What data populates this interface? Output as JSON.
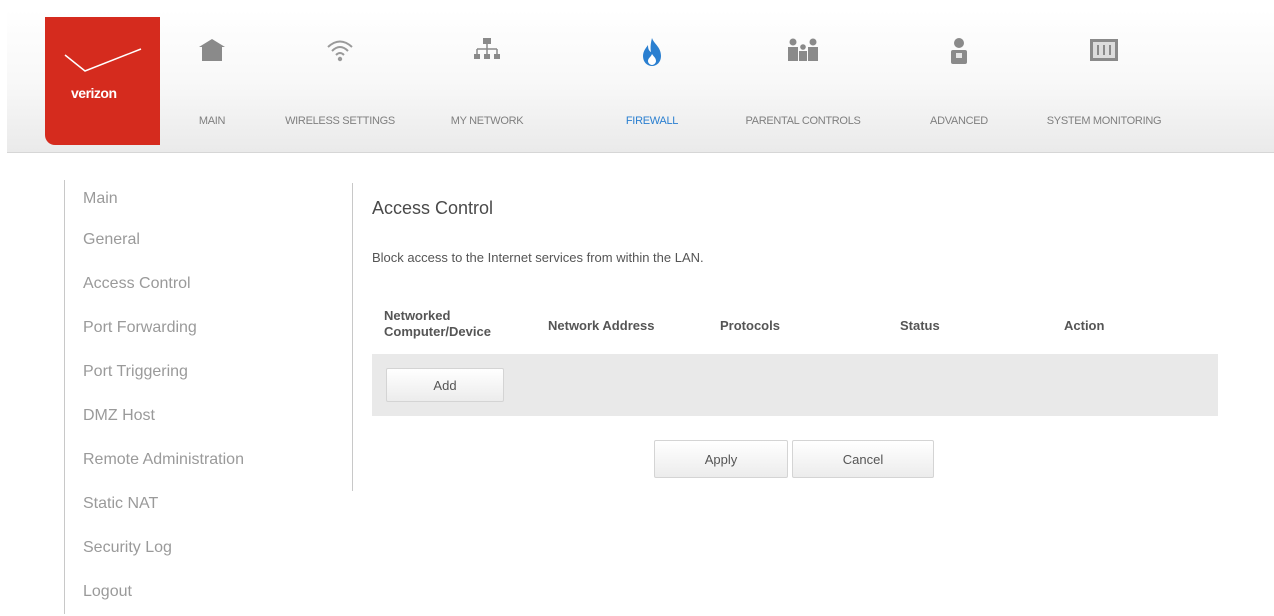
{
  "brand": {
    "logo_text": "verizon",
    "accent": "#d52b1e"
  },
  "nav": [
    {
      "id": "main",
      "label": "MAIN",
      "icon": "house-icon"
    },
    {
      "id": "wireless",
      "label": "WIRELESS SETTINGS",
      "icon": "wifi-icon"
    },
    {
      "id": "network",
      "label": "MY NETWORK",
      "icon": "network-icon"
    },
    {
      "id": "firewall",
      "label": "FIREWALL",
      "icon": "flame-icon",
      "active": true
    },
    {
      "id": "parental",
      "label": "PARENTAL CONTROLS",
      "icon": "family-icon"
    },
    {
      "id": "advanced",
      "label": "ADVANCED",
      "icon": "person-icon"
    },
    {
      "id": "monitoring",
      "label": "SYSTEM MONITORING",
      "icon": "monitor-icon"
    }
  ],
  "active_color": "#2a7fd0",
  "sidebar": {
    "items": [
      {
        "label": "Main"
      },
      {
        "label": "General"
      },
      {
        "label": "Access Control"
      },
      {
        "label": "Port Forwarding"
      },
      {
        "label": "Port Triggering"
      },
      {
        "label": "DMZ Host"
      },
      {
        "label": "Remote Administration"
      },
      {
        "label": "Static NAT"
      },
      {
        "label": "Security Log"
      },
      {
        "label": "Logout"
      }
    ]
  },
  "content": {
    "title": "Access Control",
    "description": "Block access to the Internet services from within the LAN.",
    "table": {
      "headers": {
        "device_line1": "Networked",
        "device_line2": "Computer/Device",
        "address": "Network Address",
        "protocols": "Protocols",
        "status": "Status",
        "action": "Action"
      },
      "add_label": "Add"
    },
    "apply_label": "Apply",
    "cancel_label": "Cancel"
  }
}
